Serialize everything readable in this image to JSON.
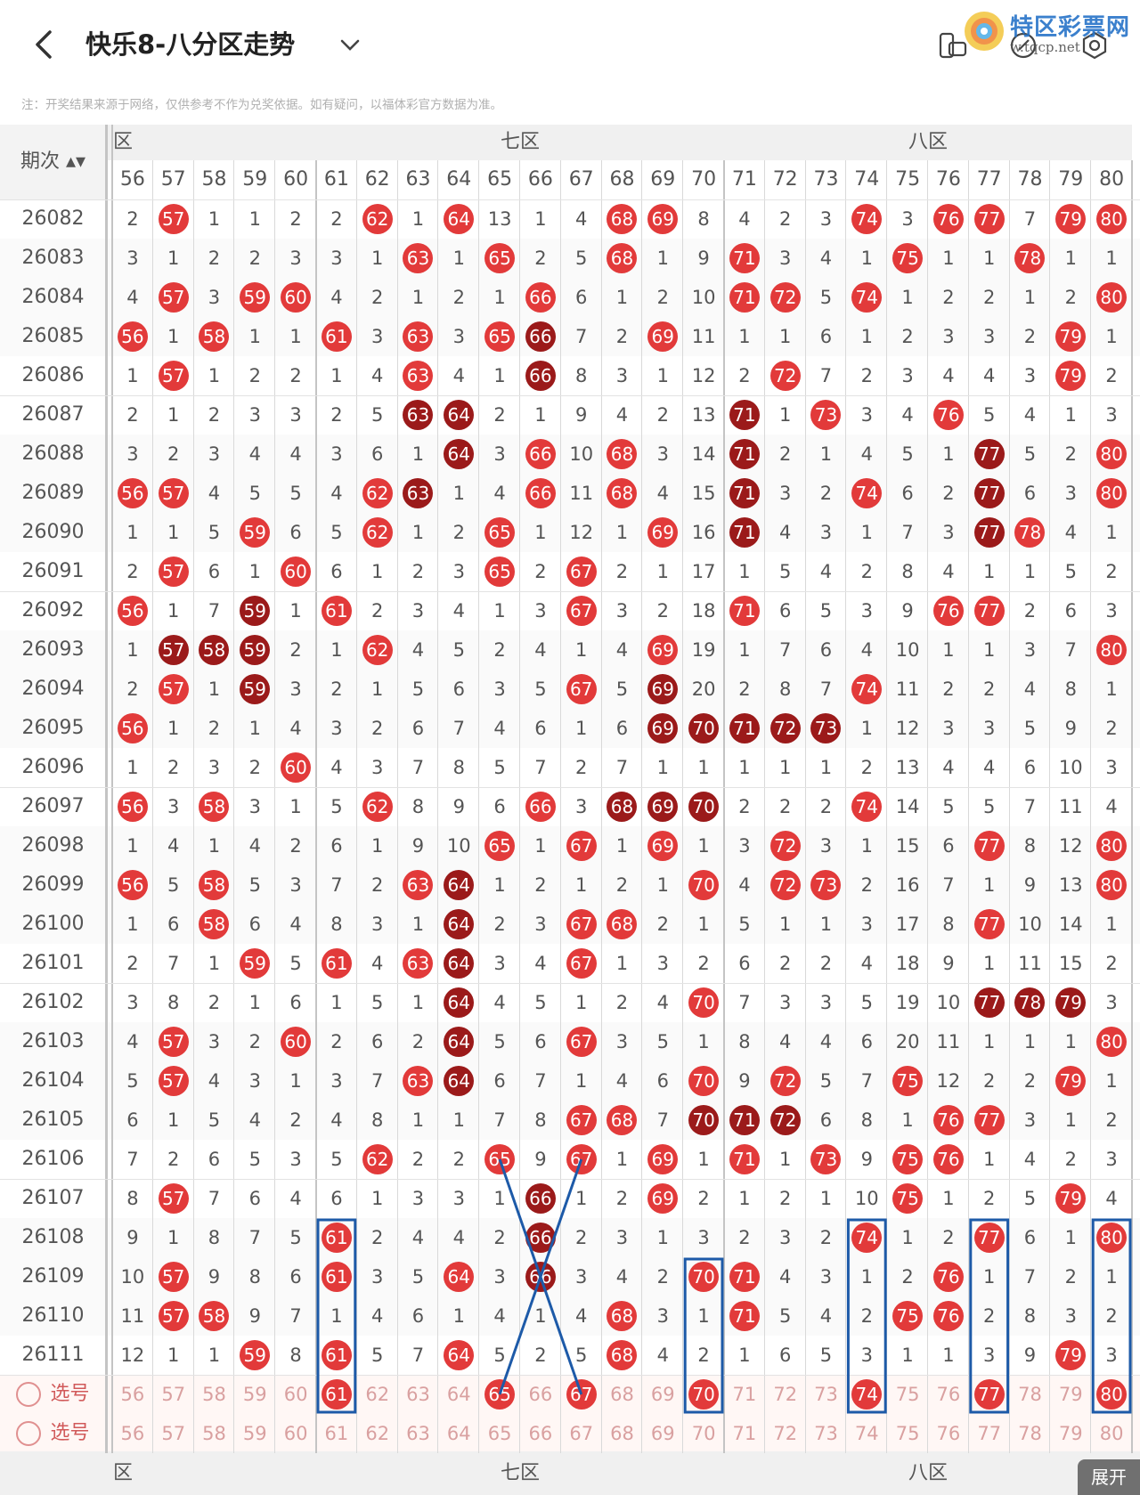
{
  "header": {
    "title": "快乐8-八分区走势",
    "watermark_text": "特区彩票网",
    "watermark_url": "w.tqcp.net"
  },
  "notice": "注：开奖结果来源于网络，仅供参考不作为兑奖依据。如有疑问，以福体彩官方数据为准。",
  "table": {
    "period_label": "期次",
    "zones": [
      {
        "label": "六区",
        "shown": "六区"
      },
      {
        "label": "七区"
      },
      {
        "label": "八区"
      }
    ],
    "columns": [
      "56",
      "57",
      "58",
      "59",
      "60",
      "61",
      "62",
      "63",
      "64",
      "65",
      "66",
      "67",
      "68",
      "69",
      "70",
      "71",
      "72",
      "73",
      "74",
      "75",
      "76",
      "77",
      "78",
      "79",
      "80"
    ],
    "rows": [
      {
        "p": "26082",
        "c": [
          "2",
          "57",
          "1",
          "1",
          "2",
          "2",
          "62",
          "1",
          "64",
          "13",
          "1",
          "4",
          "68",
          "69",
          "8",
          "4",
          "2",
          "3",
          "74",
          "3",
          "76",
          "77",
          "7",
          "79",
          "80"
        ]
      },
      {
        "p": "26083",
        "c": [
          "3",
          "1",
          "2",
          "2",
          "3",
          "3",
          "1",
          "63",
          "1",
          "65",
          "2",
          "5",
          "68",
          "1",
          "9",
          "71",
          "3",
          "4",
          "1",
          "75",
          "1",
          "1",
          "78",
          "1",
          "1"
        ]
      },
      {
        "p": "26084",
        "c": [
          "4",
          "57",
          "3",
          "59",
          "60",
          "4",
          "2",
          "1",
          "2",
          "1",
          "66",
          "6",
          "1",
          "2",
          "10",
          "71",
          "72",
          "5",
          "74",
          "1",
          "2",
          "2",
          "1",
          "2",
          "80"
        ]
      },
      {
        "p": "26085",
        "c": [
          "56",
          "1",
          "58",
          "1",
          "1",
          "61",
          "3",
          "63",
          "3",
          "65",
          "66",
          "7",
          "2",
          "69",
          "11",
          "1",
          "1",
          "6",
          "1",
          "2",
          "3",
          "3",
          "2",
          "79",
          "1"
        ]
      },
      {
        "p": "26086",
        "c": [
          "1",
          "57",
          "1",
          "2",
          "2",
          "1",
          "4",
          "63",
          "4",
          "1",
          "66",
          "8",
          "3",
          "1",
          "12",
          "2",
          "72",
          "7",
          "2",
          "3",
          "4",
          "4",
          "3",
          "79",
          "2"
        ]
      },
      {
        "p": "26087",
        "c": [
          "2",
          "1",
          "2",
          "3",
          "3",
          "2",
          "5",
          "63",
          "64",
          "2",
          "1",
          "9",
          "4",
          "2",
          "13",
          "71",
          "1",
          "73",
          "3",
          "4",
          "76",
          "5",
          "4",
          "1",
          "3"
        ]
      },
      {
        "p": "26088",
        "c": [
          "3",
          "2",
          "3",
          "4",
          "4",
          "3",
          "6",
          "1",
          "64",
          "3",
          "66",
          "10",
          "68",
          "3",
          "14",
          "71",
          "2",
          "1",
          "4",
          "5",
          "1",
          "77",
          "5",
          "2",
          "80"
        ]
      },
      {
        "p": "26089",
        "c": [
          "56",
          "57",
          "4",
          "5",
          "5",
          "4",
          "62",
          "63",
          "1",
          "4",
          "66",
          "11",
          "68",
          "4",
          "15",
          "71",
          "3",
          "2",
          "74",
          "6",
          "2",
          "77",
          "6",
          "3",
          "80"
        ]
      },
      {
        "p": "26090",
        "c": [
          "1",
          "1",
          "5",
          "59",
          "6",
          "5",
          "62",
          "1",
          "2",
          "65",
          "1",
          "12",
          "1",
          "69",
          "16",
          "71",
          "4",
          "3",
          "1",
          "7",
          "3",
          "77",
          "78",
          "4",
          "1"
        ]
      },
      {
        "p": "26091",
        "c": [
          "2",
          "57",
          "6",
          "1",
          "60",
          "6",
          "1",
          "2",
          "3",
          "65",
          "2",
          "67",
          "2",
          "1",
          "17",
          "1",
          "5",
          "4",
          "2",
          "8",
          "4",
          "1",
          "1",
          "5",
          "2"
        ]
      },
      {
        "p": "26092",
        "c": [
          "56",
          "1",
          "7",
          "59",
          "1",
          "61",
          "2",
          "3",
          "4",
          "1",
          "3",
          "67",
          "3",
          "2",
          "18",
          "71",
          "6",
          "5",
          "3",
          "9",
          "76",
          "77",
          "2",
          "6",
          "3"
        ]
      },
      {
        "p": "26093",
        "c": [
          "1",
          "57",
          "58",
          "59",
          "2",
          "1",
          "62",
          "4",
          "5",
          "2",
          "4",
          "1",
          "4",
          "69",
          "19",
          "1",
          "7",
          "6",
          "4",
          "10",
          "1",
          "1",
          "3",
          "7",
          "80"
        ]
      },
      {
        "p": "26094",
        "c": [
          "2",
          "57",
          "1",
          "59",
          "3",
          "2",
          "1",
          "5",
          "6",
          "3",
          "5",
          "67",
          "5",
          "69",
          "20",
          "2",
          "8",
          "7",
          "74",
          "11",
          "2",
          "2",
          "4",
          "8",
          "1"
        ]
      },
      {
        "p": "26095",
        "c": [
          "56",
          "1",
          "2",
          "1",
          "4",
          "3",
          "2",
          "6",
          "7",
          "4",
          "6",
          "1",
          "6",
          "69",
          "70",
          "71",
          "72",
          "73",
          "1",
          "12",
          "3",
          "3",
          "5",
          "9",
          "2"
        ]
      },
      {
        "p": "26096",
        "c": [
          "1",
          "2",
          "3",
          "2",
          "60",
          "4",
          "3",
          "7",
          "8",
          "5",
          "7",
          "2",
          "7",
          "1",
          "1",
          "1",
          "1",
          "1",
          "2",
          "13",
          "4",
          "4",
          "6",
          "10",
          "3"
        ]
      },
      {
        "p": "26097",
        "c": [
          "56",
          "3",
          "58",
          "3",
          "1",
          "5",
          "62",
          "8",
          "9",
          "6",
          "66",
          "3",
          "68",
          "69",
          "70",
          "2",
          "2",
          "2",
          "74",
          "14",
          "5",
          "5",
          "7",
          "11",
          "4"
        ]
      },
      {
        "p": "26098",
        "c": [
          "1",
          "4",
          "1",
          "4",
          "2",
          "6",
          "1",
          "9",
          "10",
          "65",
          "1",
          "67",
          "1",
          "69",
          "1",
          "3",
          "72",
          "3",
          "1",
          "15",
          "6",
          "77",
          "8",
          "12",
          "80"
        ]
      },
      {
        "p": "26099",
        "c": [
          "56",
          "5",
          "58",
          "5",
          "3",
          "7",
          "2",
          "63",
          "64",
          "1",
          "2",
          "1",
          "2",
          "1",
          "70",
          "4",
          "72",
          "73",
          "2",
          "16",
          "7",
          "1",
          "9",
          "13",
          "80"
        ]
      },
      {
        "p": "26100",
        "c": [
          "1",
          "6",
          "58",
          "6",
          "4",
          "8",
          "3",
          "1",
          "64",
          "2",
          "3",
          "67",
          "68",
          "2",
          "1",
          "5",
          "1",
          "1",
          "3",
          "17",
          "8",
          "77",
          "10",
          "14",
          "1"
        ]
      },
      {
        "p": "26101",
        "c": [
          "2",
          "7",
          "1",
          "59",
          "5",
          "61",
          "4",
          "63",
          "64",
          "3",
          "4",
          "67",
          "1",
          "3",
          "2",
          "6",
          "2",
          "2",
          "4",
          "18",
          "9",
          "1",
          "11",
          "15",
          "2"
        ]
      },
      {
        "p": "26102",
        "c": [
          "3",
          "8",
          "2",
          "1",
          "6",
          "1",
          "5",
          "1",
          "64",
          "4",
          "5",
          "1",
          "2",
          "4",
          "70",
          "7",
          "3",
          "3",
          "5",
          "19",
          "10",
          "77",
          "78",
          "79",
          "3"
        ]
      },
      {
        "p": "26103",
        "c": [
          "4",
          "57",
          "3",
          "2",
          "60",
          "2",
          "6",
          "2",
          "64",
          "5",
          "6",
          "67",
          "3",
          "5",
          "1",
          "8",
          "4",
          "4",
          "6",
          "20",
          "11",
          "1",
          "1",
          "1",
          "80"
        ]
      },
      {
        "p": "26104",
        "c": [
          "5",
          "57",
          "4",
          "3",
          "1",
          "3",
          "7",
          "63",
          "64",
          "6",
          "7",
          "1",
          "4",
          "6",
          "70",
          "9",
          "72",
          "5",
          "7",
          "75",
          "12",
          "2",
          "2",
          "79",
          "1"
        ]
      },
      {
        "p": "26105",
        "c": [
          "6",
          "1",
          "5",
          "4",
          "2",
          "4",
          "8",
          "1",
          "1",
          "7",
          "8",
          "67",
          "68",
          "7",
          "70",
          "71",
          "72",
          "6",
          "8",
          "1",
          "76",
          "77",
          "3",
          "1",
          "2"
        ]
      },
      {
        "p": "26106",
        "c": [
          "7",
          "2",
          "6",
          "5",
          "3",
          "5",
          "62",
          "2",
          "2",
          "65",
          "9",
          "67",
          "1",
          "69",
          "1",
          "71",
          "1",
          "73",
          "9",
          "75",
          "76",
          "1",
          "4",
          "2",
          "3"
        ]
      },
      {
        "p": "26107",
        "c": [
          "8",
          "57",
          "7",
          "6",
          "4",
          "6",
          "1",
          "3",
          "3",
          "1",
          "66",
          "1",
          "2",
          "69",
          "2",
          "1",
          "2",
          "1",
          "10",
          "75",
          "1",
          "2",
          "5",
          "79",
          "4"
        ]
      },
      {
        "p": "26108",
        "c": [
          "9",
          "1",
          "8",
          "7",
          "5",
          "61",
          "2",
          "4",
          "4",
          "2",
          "66",
          "2",
          "3",
          "1",
          "3",
          "2",
          "3",
          "2",
          "74",
          "1",
          "2",
          "77",
          "6",
          "1",
          "80"
        ]
      },
      {
        "p": "26109",
        "c": [
          "10",
          "57",
          "9",
          "8",
          "6",
          "61",
          "3",
          "5",
          "64",
          "3",
          "66",
          "3",
          "4",
          "2",
          "70",
          "71",
          "4",
          "3",
          "1",
          "2",
          "76",
          "1",
          "7",
          "2",
          "1"
        ]
      },
      {
        "p": "26110",
        "c": [
          "11",
          "57",
          "58",
          "9",
          "7",
          "1",
          "4",
          "6",
          "1",
          "4",
          "1",
          "4",
          "68",
          "3",
          "1",
          "71",
          "5",
          "4",
          "2",
          "75",
          "76",
          "2",
          "8",
          "3",
          "2"
        ]
      },
      {
        "p": "26111",
        "c": [
          "12",
          "1",
          "1",
          "59",
          "8",
          "61",
          "5",
          "7",
          "64",
          "5",
          "2",
          "5",
          "68",
          "4",
          "2",
          "1",
          "6",
          "5",
          "3",
          "1",
          "1",
          "3",
          "9",
          "79",
          "3"
        ]
      }
    ],
    "dark_cells": [
      [
        3,
        10
      ],
      [
        4,
        10
      ],
      [
        5,
        7
      ],
      [
        6,
        7
      ],
      [
        7,
        7
      ],
      [
        5,
        8
      ],
      [
        6,
        8
      ],
      [
        7,
        8
      ],
      [
        8,
        8
      ],
      [
        5,
        15
      ],
      [
        6,
        15
      ],
      [
        7,
        15
      ],
      [
        8,
        15
      ],
      [
        11,
        1
      ],
      [
        11,
        2
      ],
      [
        11,
        3
      ],
      [
        12,
        3
      ],
      [
        10,
        3
      ],
      [
        13,
        13
      ],
      [
        13,
        14
      ],
      [
        13,
        15
      ],
      [
        13,
        16
      ],
      [
        13,
        17
      ],
      [
        12,
        13
      ],
      [
        15,
        13
      ],
      [
        15,
        14
      ],
      [
        15,
        12
      ],
      [
        17,
        8
      ],
      [
        18,
        8
      ],
      [
        19,
        8
      ],
      [
        20,
        8
      ],
      [
        21,
        8
      ],
      [
        22,
        8
      ],
      [
        20,
        21
      ],
      [
        20,
        22
      ],
      [
        20,
        23
      ],
      [
        6,
        21
      ],
      [
        7,
        21
      ],
      [
        8,
        21
      ],
      [
        23,
        14
      ],
      [
        23,
        15
      ],
      [
        23,
        16
      ],
      [
        24,
        10
      ],
      [
        25,
        10
      ],
      [
        26,
        10
      ],
      [
        27,
        10
      ]
    ],
    "select_rows": [
      {
        "label": "选号",
        "cols": [
          "56",
          "57",
          "58",
          "59",
          "60",
          "61",
          "62",
          "63",
          "64",
          "65",
          "66",
          "67",
          "68",
          "69",
          "70",
          "71",
          "72",
          "73",
          "74",
          "75",
          "76",
          "77",
          "78",
          "79",
          "80"
        ],
        "picked": [
          "61",
          "65",
          "67",
          "70",
          "74",
          "77",
          "80"
        ]
      },
      {
        "label": "选号",
        "cols": [
          "56",
          "57",
          "58",
          "59",
          "60",
          "61",
          "62",
          "63",
          "64",
          "65",
          "66",
          "67",
          "68",
          "69",
          "70",
          "71",
          "72",
          "73",
          "74",
          "75",
          "76",
          "77",
          "78",
          "79",
          "80"
        ],
        "picked": []
      }
    ]
  },
  "footer": {
    "expand_label": "展开"
  },
  "colors": {
    "ball": "#e23a3a",
    "ball_dark": "#9b1a1a",
    "annotation": "#1d5aa8"
  }
}
